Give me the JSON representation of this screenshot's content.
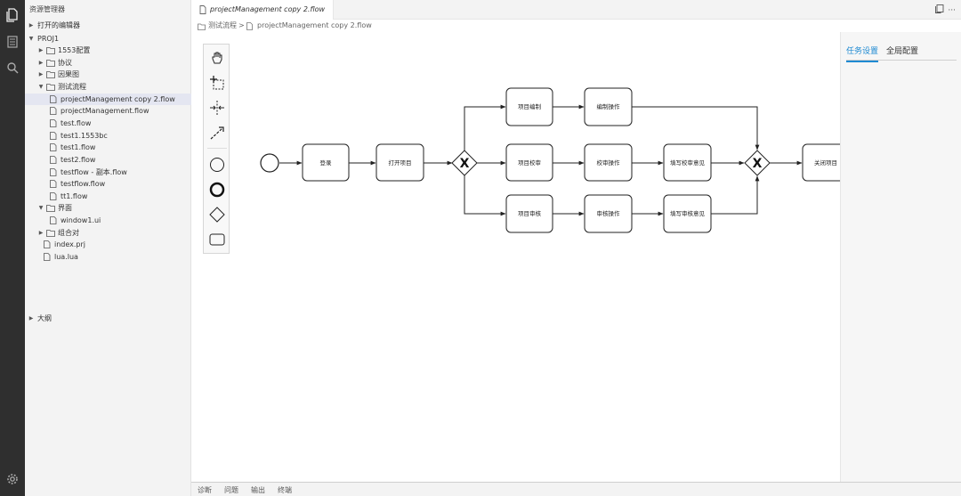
{
  "sidebar": {
    "title": "资源管理器",
    "open_editors": "打开的编辑器",
    "project": "PROJ1",
    "outline": "大纲",
    "tree": [
      {
        "label": "1553配置",
        "kind": "folder",
        "state": "collapsed"
      },
      {
        "label": "协议",
        "kind": "folder",
        "state": "collapsed"
      },
      {
        "label": "因果图",
        "kind": "folder",
        "state": "collapsed"
      },
      {
        "label": "测试流程",
        "kind": "folder",
        "state": "expanded"
      },
      {
        "label": "projectManagement copy 2.flow",
        "kind": "file",
        "selected": true
      },
      {
        "label": "projectManagement.flow",
        "kind": "file"
      },
      {
        "label": "test.flow",
        "kind": "file"
      },
      {
        "label": "test1.1553bc",
        "kind": "file"
      },
      {
        "label": "test1.flow",
        "kind": "file"
      },
      {
        "label": "test2.flow",
        "kind": "file"
      },
      {
        "label": "testflow - 副本.flow",
        "kind": "file"
      },
      {
        "label": "testflow.flow",
        "kind": "file"
      },
      {
        "label": "tt1.flow",
        "kind": "file"
      },
      {
        "label": "界面",
        "kind": "folder",
        "state": "expanded"
      },
      {
        "label": "window1.ui",
        "kind": "file"
      },
      {
        "label": "组合对",
        "kind": "folder",
        "state": "collapsed"
      },
      {
        "label": "index.prj",
        "kind": "file"
      },
      {
        "label": "lua.lua",
        "kind": "file"
      }
    ]
  },
  "editor": {
    "tab_label": "projectManagement copy 2.flow",
    "actions": [
      "split-editor-icon",
      "more-icon"
    ],
    "more_label": "···",
    "breadcrumb": [
      "测试流程",
      "projectManagement copy 2.flow"
    ],
    "breadcrumb_sep": ">"
  },
  "palette": [
    "hand-tool-icon",
    "lasso-tool-icon",
    "space-tool-icon",
    "global-connect-icon",
    "start-event-icon",
    "end-event-icon",
    "gateway-icon",
    "task-icon"
  ],
  "diagram": {
    "tasks": {
      "login": "登录",
      "open_project": "打开项目",
      "project_compile": "项目编制",
      "compile_op": "编制操作",
      "project_proofread": "项目校审",
      "proofread_op": "校审操作",
      "fill_proofread": "填写校审意见",
      "project_review": "项目审核",
      "review_op": "审核操作",
      "fill_review": "填写审核意见",
      "close_project": "关闭项目"
    },
    "gateway_symbol": "X"
  },
  "properties": {
    "tabs": [
      {
        "label": "任务设置",
        "active": true
      },
      {
        "label": "全局配置",
        "active": false
      }
    ]
  },
  "bottom_panel": {
    "tabs": [
      "诊断",
      "问题",
      "输出",
      "终端"
    ]
  },
  "colors": {
    "activity_bar": "#2f2f2f",
    "sidebar_bg": "#f3f3f3",
    "selected_row": "#e4e6f1",
    "accent": "#1f8ad2"
  }
}
